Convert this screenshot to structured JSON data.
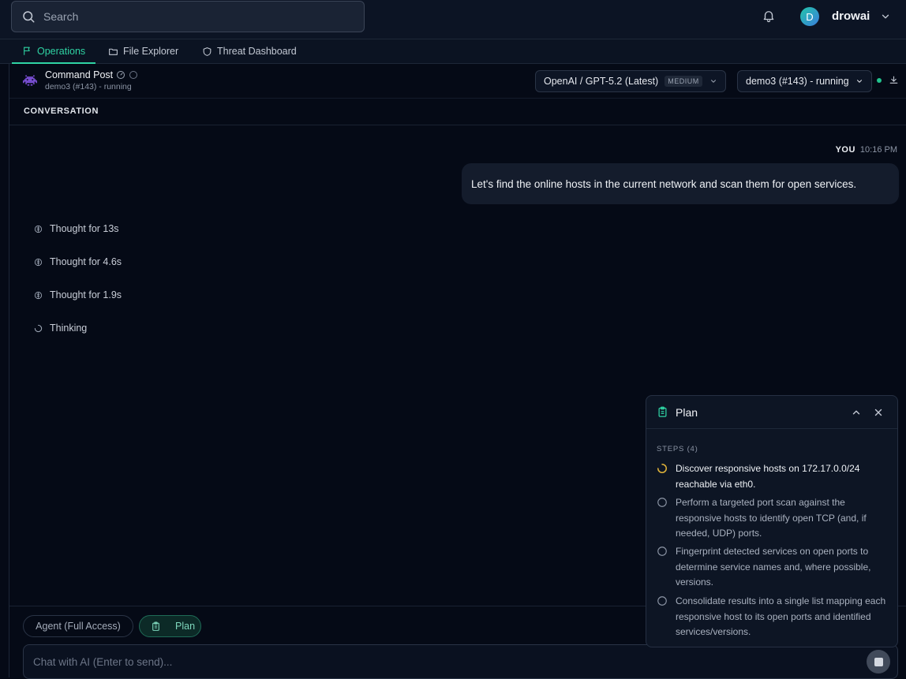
{
  "search": {
    "placeholder": "Search"
  },
  "user": {
    "initial": "D",
    "name": "drowai"
  },
  "tabs": [
    {
      "label": "Operations",
      "active": true
    },
    {
      "label": "File Explorer",
      "active": false
    },
    {
      "label": "Threat Dashboard",
      "active": false
    }
  ],
  "command_post": {
    "title": "Command Post",
    "subtitle": "demo3 (#143) - running"
  },
  "model_select": {
    "value": "OpenAI / GPT-5.2 (Latest)",
    "badge": "MEDIUM"
  },
  "target_select": {
    "value": "demo3 (#143) - running"
  },
  "conversation": {
    "label": "CONVERSATION",
    "user_message": {
      "author": "YOU",
      "time": "10:16 PM",
      "text": "Let's find the online hosts in the current network and scan them for open services."
    },
    "thoughts": [
      {
        "label": "Thought for 13s"
      },
      {
        "label": "Thought for 4.6s"
      },
      {
        "label": "Thought for 1.9s"
      },
      {
        "label": "Thinking"
      }
    ]
  },
  "composer": {
    "agent_mode": "Agent (Full Access)",
    "plan_label": "Plan",
    "placeholder": "Chat with AI (Enter to send)..."
  },
  "plan": {
    "title": "Plan",
    "steps_label": "STEPS (4)",
    "steps": [
      {
        "text": "Discover responsive hosts on 172.17.0.0/24 reachable via eth0.",
        "status": "in-progress"
      },
      {
        "text": "Perform a targeted port scan against the responsive hosts to identify open TCP (and, if needed, UDP) ports.",
        "status": "pending"
      },
      {
        "text": "Fingerprint detected services on open ports to determine service names and, where possible, versions.",
        "status": "pending"
      },
      {
        "text": "Consolidate results into a single list mapping each responsive host to its open ports and identified services/versions.",
        "status": "pending"
      }
    ]
  },
  "colors": {
    "accent": "#2fd3a3",
    "background": "#050a16",
    "in_progress": "#e0b33a",
    "online": "#22c38e"
  }
}
